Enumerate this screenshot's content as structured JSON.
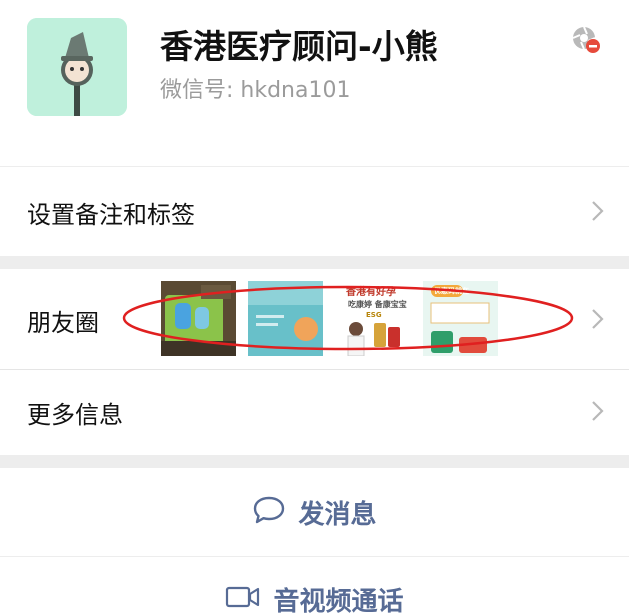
{
  "profile": {
    "name": "香港医疗顾问-小熊",
    "wechat_id": "微信号: hkdna101"
  },
  "rows": {
    "remark_label": "设置备注和标签",
    "moments_label": "朋友圈",
    "more_info_label": "更多信息"
  },
  "moments_thumbnails": {
    "thumb3_title": "香港有好孕",
    "thumb3_sub": "吃康婷 备康宝宝",
    "thumb3_tag": "ESG",
    "thumb4_title": "优惠码就在"
  },
  "actions": {
    "send_message_label": "发消息",
    "video_call_label": "音视频通话"
  },
  "colors": {
    "link_blue": "#576b95",
    "annotation_red": "#e02020",
    "avatar_bg": "#bff0dc"
  },
  "icons": {
    "status": "blocked-badge-icon",
    "chat": "chat-bubble-icon",
    "video": "video-camera-icon",
    "chevron": "chevron-right-icon"
  }
}
